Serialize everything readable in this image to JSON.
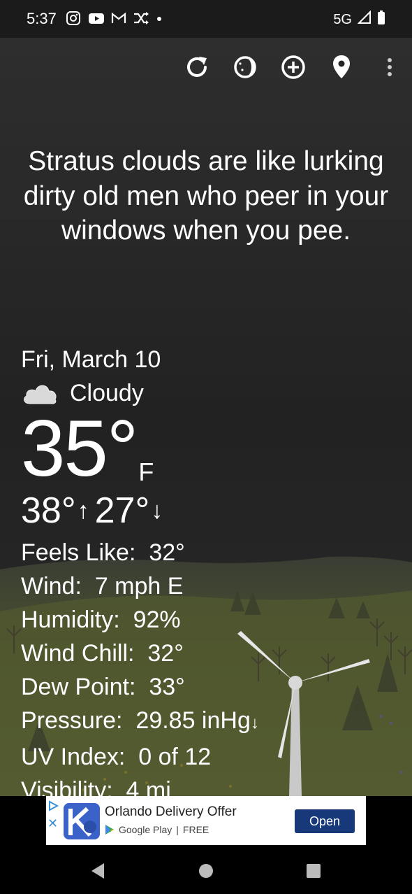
{
  "status_bar": {
    "time": "5:37",
    "network": "5G",
    "left_icons": [
      "instagram-icon",
      "youtube-icon",
      "gmail-icon",
      "shuffle-icon",
      "dot-icon"
    ],
    "right_icons": [
      "signal-icon",
      "battery-icon"
    ]
  },
  "toolbar": {
    "icons": [
      "refresh-icon",
      "moon-phase-icon",
      "add-location-icon",
      "location-pin-icon",
      "more-vert-icon"
    ]
  },
  "quote": "Stratus clouds are like lurking dirty old men who peer in your windows when you pee.",
  "weather": {
    "date": "Fri, March 10",
    "condition": "Cloudy",
    "condition_icon": "cloud-icon",
    "temp": "35°",
    "unit": "F",
    "high": "38°",
    "low": "27°",
    "details": [
      {
        "label": "Feels Like:",
        "value": "32°"
      },
      {
        "label": "Wind:",
        "value": "7 mph E"
      },
      {
        "label": "Humidity:",
        "value": "92%"
      },
      {
        "label": "Wind Chill:",
        "value": "32°"
      },
      {
        "label": "Dew Point:",
        "value": "33°"
      },
      {
        "label": "Pressure:",
        "value": "29.85 inHg"
      },
      {
        "label": "UV Index:",
        "value": "0 of 12"
      },
      {
        "label": "Visibility:",
        "value": "4 mi"
      }
    ]
  },
  "ad": {
    "title": "Orlando Delivery Offer",
    "store": "Google Play",
    "price": "FREE",
    "button": "Open"
  },
  "nav": {
    "icons": [
      "back-icon",
      "home-icon",
      "recents-icon"
    ]
  },
  "colors": {
    "sky": "#262626",
    "ad_button": "#17397a",
    "hill": "#4a5230"
  }
}
